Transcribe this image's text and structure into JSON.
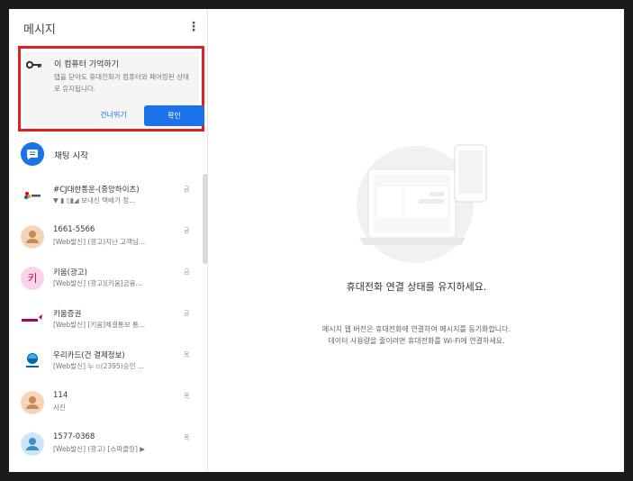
{
  "sidebar": {
    "title": "메시지",
    "more_icon": "more-vert-icon",
    "remember": {
      "title": "이 컴퓨터 기억하기",
      "desc": "탭을 닫아도 휴대전화가 컴퓨터와 페어링된 상태로 유지됩니다.",
      "skip": "건너뛰기",
      "confirm": "확인"
    },
    "start_chat": "채팅 시작",
    "conversations": [
      {
        "name": "#CJ대한통운-(중앙하이츠)",
        "snippet": "▼ ▮ ▯▮◢ 보내신 택배가 정...",
        "time": "금",
        "avatar": "cj-logo"
      },
      {
        "name": "1661-5566",
        "snippet": "[Web발신] (광고)지난 고객님...",
        "time": "금",
        "avatar": "person"
      },
      {
        "name": "키움(광고)",
        "snippet": "[Web발신] (광고)[키움]금융...",
        "time": "금",
        "avatar": "letter",
        "letter": "키"
      },
      {
        "name": "키움증권",
        "snippet": "[Web발신] [키움]체결통보 통...",
        "time": "금",
        "avatar": "kiwoom-logo"
      },
      {
        "name": "우리카드(건 결제정보)",
        "snippet": "[Web발신] 누 ▫(2395)승인 ...",
        "time": "목",
        "avatar": "woori-logo"
      },
      {
        "name": "114",
        "snippet": "사진",
        "time": "목",
        "avatar": "person"
      },
      {
        "name": "1577-0368",
        "snippet": "[Web발신] (광고) [스파클링] ▶",
        "time": "목",
        "avatar": "person-blue"
      }
    ]
  },
  "main": {
    "title": "휴대전화 연결 상태를 유지하세요.",
    "desc_line1": "메시지 웹 버전은 휴대전화에 연결하여 메시지를 동기화합니다.",
    "desc_line2": "데이터 사용량을 줄이려면 휴대전화를 Wi-Fi에 연결하세요."
  },
  "colors": {
    "accent": "#1a73e8",
    "highlight_border": "#e02020",
    "avatar_orange": "#f5d5b8",
    "avatar_pink": "#fbd3e9"
  }
}
